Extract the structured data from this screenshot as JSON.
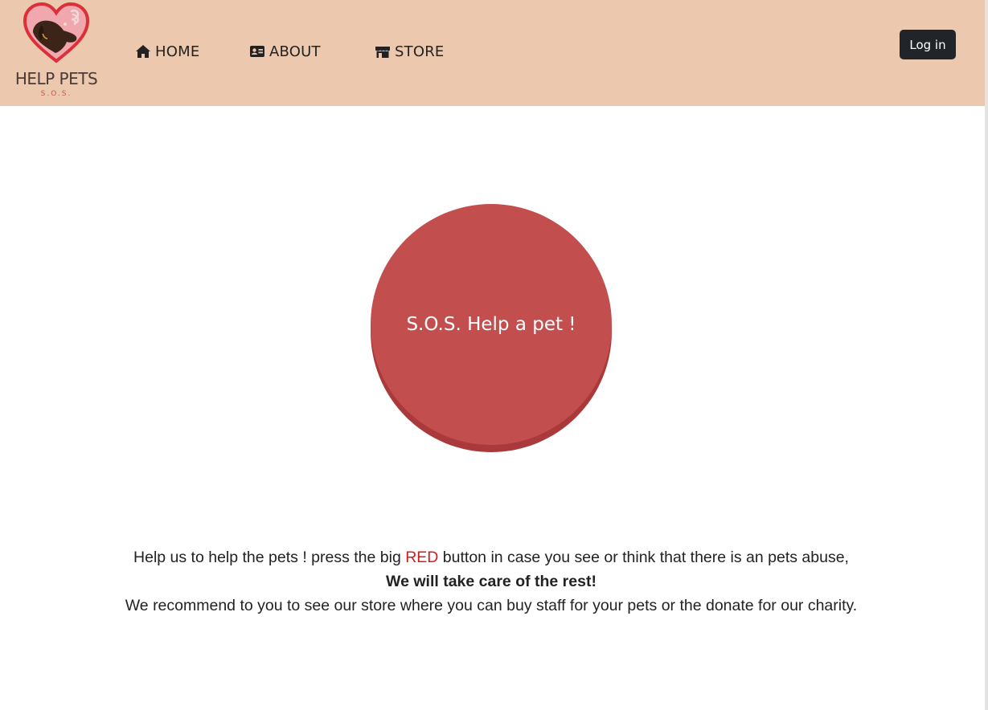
{
  "brand": {
    "name": "HELP PETS",
    "tagline": "S.O.S.",
    "colors": {
      "header_bg": "#ecc9ae",
      "heart_outline": "#d9303a",
      "heart_fill": "#f0a7ad",
      "dog": "#3c2418"
    }
  },
  "nav": {
    "items": [
      {
        "label": "HOME",
        "icon": "home-icon"
      },
      {
        "label": "ABOUT",
        "icon": "id-card-icon"
      },
      {
        "label": "STORE",
        "icon": "store-icon"
      }
    ],
    "login_label": "Log in"
  },
  "main": {
    "sos_button_label": "S.O.S. Help a pet !",
    "sos_button_color": "#c24e4e",
    "line1_before": "Help us to help the pets ! press the big ",
    "line1_highlight": "RED",
    "line1_after": " button in case you see or think that there is an pets abuse,",
    "line2": "We will take care of the rest!",
    "line3": "We recommend to you to see our store where you can buy staff for your pets or the donate for our charity."
  }
}
